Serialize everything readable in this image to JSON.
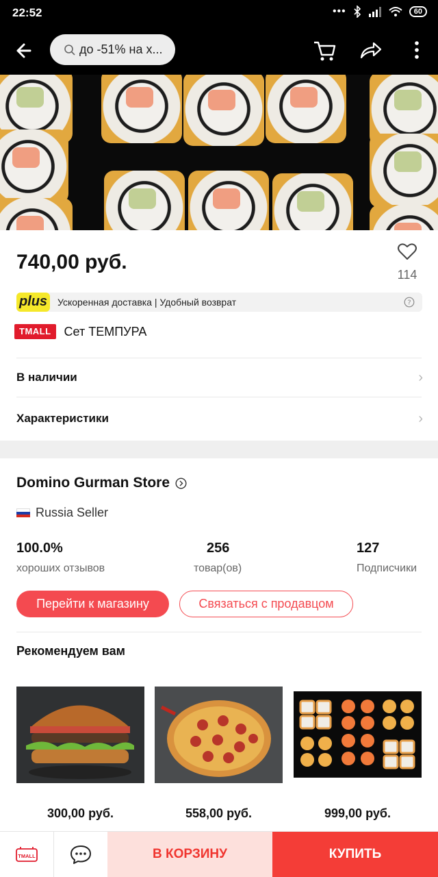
{
  "status_bar": {
    "time": "22:52",
    "dots": "•••",
    "battery": "60"
  },
  "header": {
    "search_text": "до -51% на х..."
  },
  "product": {
    "price": "740,00 руб.",
    "favorites_count": "114",
    "plus_logo": "plus",
    "plus_text": "Ускоренная доставка | Удобный возврат",
    "tmall_badge": "TMALL",
    "name": "Сет ТЕМПУРА"
  },
  "rows": {
    "availability": "В наличии",
    "specs": "Характеристики"
  },
  "store": {
    "name": "Domino Gurman Store",
    "seller": "Russia Seller",
    "stats": [
      {
        "value": "100.0%",
        "label": "хороших отзывов"
      },
      {
        "value": "256",
        "label": "товар(ов)"
      },
      {
        "value": "127",
        "label": "Подписчики"
      }
    ],
    "go_to_store": "Перейти к магазину",
    "contact_seller": "Связаться с продавцом"
  },
  "recommend": {
    "title": "Рекомендуем вам",
    "items": [
      {
        "price": "300,00 руб.",
        "image": "burger"
      },
      {
        "price": "558,00 руб.",
        "image": "pizza"
      },
      {
        "price": "999,00 руб.",
        "image": "sushi-set"
      }
    ]
  },
  "bottom_bar": {
    "tmall_label": "TMALL",
    "cart": "В КОРЗИНУ",
    "buy": "КУПИТЬ"
  },
  "colors": {
    "accent": "#f44a50",
    "buy": "#f43d37",
    "cart_bg": "#fde0dc",
    "plus_yellow": "#f5e82a",
    "tmall_red": "#e11b2c"
  }
}
